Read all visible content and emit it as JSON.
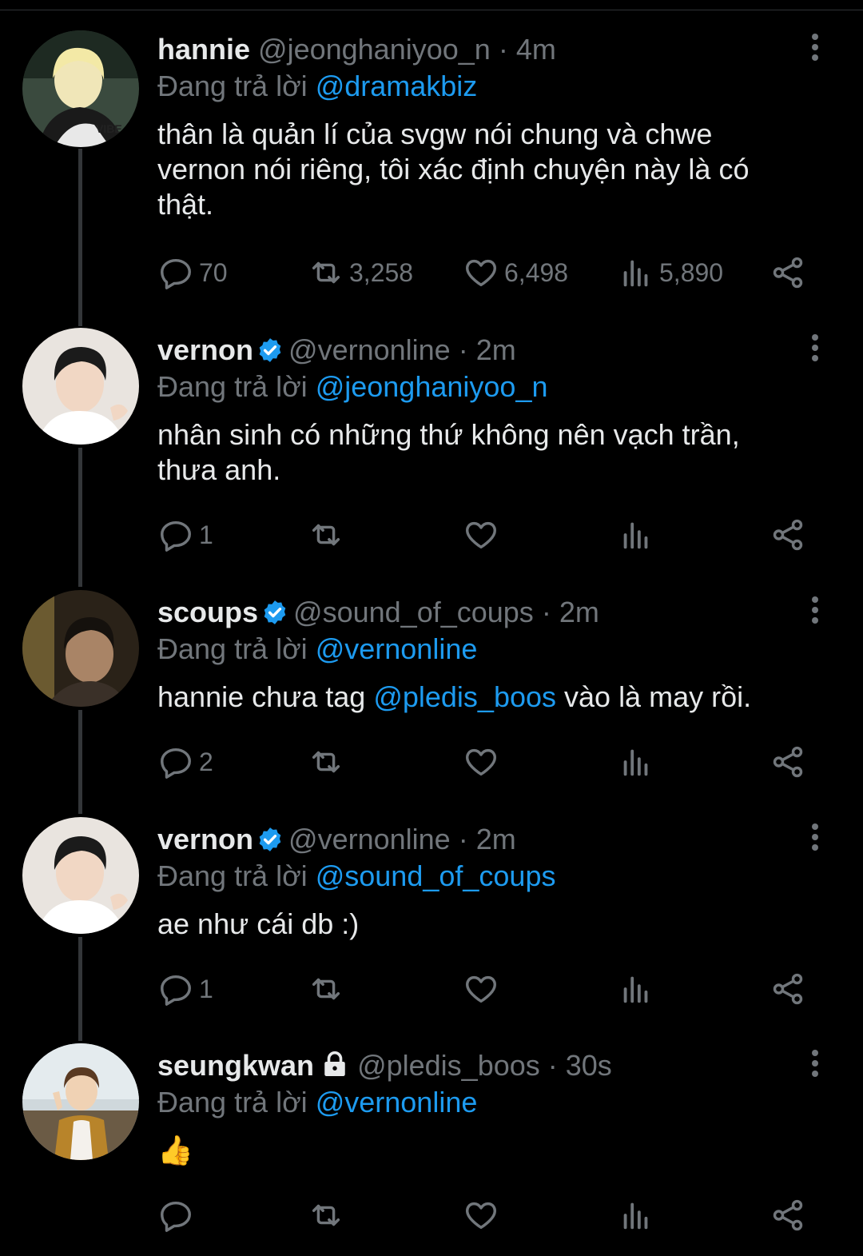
{
  "tweets": [
    {
      "name": "hannie",
      "handle": "@jeonghaniyoo_n",
      "time": "4m",
      "verified": false,
      "protected": false,
      "replying_label": "Đang trả lời",
      "replying_to": "@dramakbiz",
      "text": "thân là quản lí của svgw nói chung và chwe vernon nói riêng, tôi xác định chuyện này là có thật.",
      "replies": "70",
      "retweets": "3,258",
      "likes": "6,498",
      "views": "5,890"
    },
    {
      "name": "vernon",
      "handle": "@vernonline",
      "time": "2m",
      "verified": true,
      "protected": false,
      "replying_label": "Đang trả lời",
      "replying_to": "@jeonghaniyoo_n",
      "text": "nhân sinh có những thứ không nên vạch trần, thưa anh.",
      "replies": "1",
      "retweets": "",
      "likes": "",
      "views": ""
    },
    {
      "name": "scoups",
      "handle": "@sound_of_coups",
      "time": "2m",
      "verified": true,
      "protected": false,
      "replying_label": "Đang trả lời",
      "replying_to": "@vernonline",
      "text_before": "hannie chưa tag ",
      "text_mention": "@pledis_boos",
      "text_after": " vào là may rồi.",
      "replies": "2",
      "retweets": "",
      "likes": "",
      "views": ""
    },
    {
      "name": "vernon",
      "handle": "@vernonline",
      "time": "2m",
      "verified": true,
      "protected": false,
      "replying_label": "Đang trả lời",
      "replying_to": "@sound_of_coups",
      "text": "ae như cái db :)",
      "replies": "1",
      "retweets": "",
      "likes": "",
      "views": ""
    },
    {
      "name": "seungkwan",
      "handle": "@pledis_boos",
      "time": "30s",
      "verified": false,
      "protected": true,
      "replying_label": "Đang trả lời",
      "replying_to": "@vernonline",
      "text": "👍",
      "replies": "",
      "retweets": "",
      "likes": "",
      "views": ""
    }
  ],
  "separator": " · ",
  "icons": {
    "reply": "reply-icon",
    "retweet": "retweet-icon",
    "like": "heart-icon",
    "views": "views-icon",
    "share": "share-icon",
    "more": "more-vertical-icon",
    "verified": "verified-badge-icon",
    "protected": "lock-icon"
  },
  "colors": {
    "background": "#000000",
    "text": "#e7e9ea",
    "muted": "#71767b",
    "accent": "#1d9bf0",
    "thread_line": "#333639"
  }
}
